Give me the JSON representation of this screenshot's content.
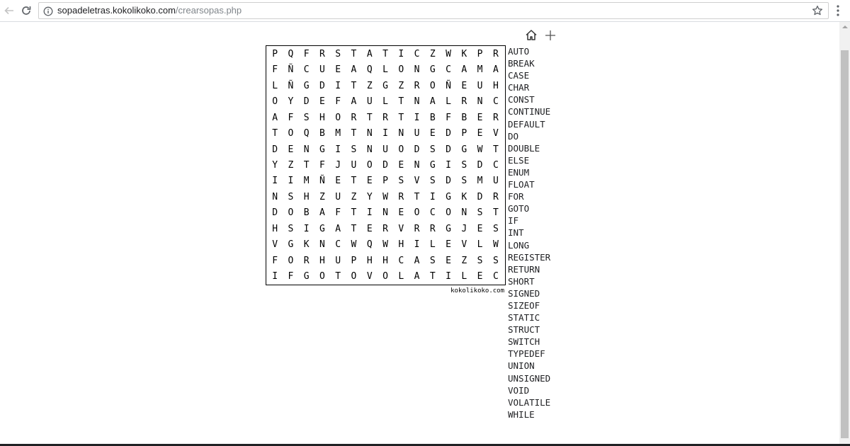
{
  "browser": {
    "url_host": "sopadeletras.kokolikoko.com",
    "url_path": "/crearsopas.php"
  },
  "puzzle": {
    "grid": [
      [
        "P",
        "Q",
        "F",
        "R",
        "S",
        "T",
        "A",
        "T",
        "I",
        "C",
        "Z",
        "W",
        "K",
        "P",
        "R"
      ],
      [
        "F",
        "Ñ",
        "C",
        "U",
        "E",
        "A",
        "Q",
        "L",
        "O",
        "N",
        "G",
        "C",
        "A",
        "M",
        "A"
      ],
      [
        "L",
        "Ñ",
        "G",
        "D",
        "I",
        "T",
        "Z",
        "G",
        "Z",
        "R",
        "O",
        "Ñ",
        "E",
        "U",
        "H"
      ],
      [
        "O",
        "Y",
        "D",
        "E",
        "F",
        "A",
        "U",
        "L",
        "T",
        "N",
        "A",
        "L",
        "R",
        "N",
        "C"
      ],
      [
        "A",
        "F",
        "S",
        "H",
        "O",
        "R",
        "T",
        "R",
        "T",
        "I",
        "B",
        "F",
        "B",
        "E",
        "R"
      ],
      [
        "T",
        "O",
        "Q",
        "B",
        "M",
        "T",
        "N",
        "I",
        "N",
        "U",
        "E",
        "D",
        "P",
        "E",
        "V"
      ],
      [
        "D",
        "E",
        "N",
        "G",
        "I",
        "S",
        "N",
        "U",
        "O",
        "D",
        "S",
        "D",
        "G",
        "W",
        "T"
      ],
      [
        "Y",
        "Z",
        "T",
        "F",
        "J",
        "U",
        "O",
        "D",
        "E",
        "N",
        "G",
        "I",
        "S",
        "D",
        "C"
      ],
      [
        "I",
        "I",
        "M",
        "Ñ",
        "E",
        "T",
        "E",
        "P",
        "S",
        "V",
        "S",
        "D",
        "S",
        "M",
        "U"
      ],
      [
        "N",
        "S",
        "H",
        "Z",
        "U",
        "Z",
        "Y",
        "W",
        "R",
        "T",
        "I",
        "G",
        "K",
        "D",
        "R"
      ],
      [
        "D",
        "O",
        "B",
        "A",
        "F",
        "T",
        "I",
        "N",
        "E",
        "O",
        "C",
        "O",
        "N",
        "S",
        "T"
      ],
      [
        "H",
        "S",
        "I",
        "G",
        "A",
        "T",
        "E",
        "R",
        "V",
        "R",
        "R",
        "G",
        "J",
        "E",
        "S"
      ],
      [
        "V",
        "G",
        "K",
        "N",
        "C",
        "W",
        "Q",
        "W",
        "H",
        "I",
        "L",
        "E",
        "V",
        "L",
        "W"
      ],
      [
        "F",
        "O",
        "R",
        "H",
        "U",
        "P",
        "H",
        "H",
        "C",
        "A",
        "S",
        "E",
        "Z",
        "S",
        "S"
      ],
      [
        "I",
        "F",
        "G",
        "O",
        "T",
        "O",
        "V",
        "O",
        "L",
        "A",
        "T",
        "I",
        "L",
        "E",
        "C"
      ]
    ],
    "credit": "kokolikoko.com",
    "words": [
      "AUTO",
      "BREAK",
      "CASE",
      "CHAR",
      "CONST",
      "CONTINUE",
      "DEFAULT",
      "DO",
      "DOUBLE",
      "ELSE",
      "ENUM",
      "FLOAT",
      "FOR",
      "GOTO",
      "IF",
      "INT",
      "LONG",
      "REGISTER",
      "RETURN",
      "SHORT",
      "SIGNED",
      "SIZEOF",
      "STATIC",
      "STRUCT",
      "SWITCH",
      "TYPEDEF",
      "UNION",
      "UNSIGNED",
      "VOID",
      "VOLATILE",
      "WHILE"
    ]
  },
  "icons": {
    "back": "arrow-left-icon",
    "reload": "reload-icon",
    "site_info": "info-icon",
    "bookmark": "star-icon",
    "menu": "kebab-menu-icon",
    "home": "home-icon",
    "add": "plus-icon"
  }
}
